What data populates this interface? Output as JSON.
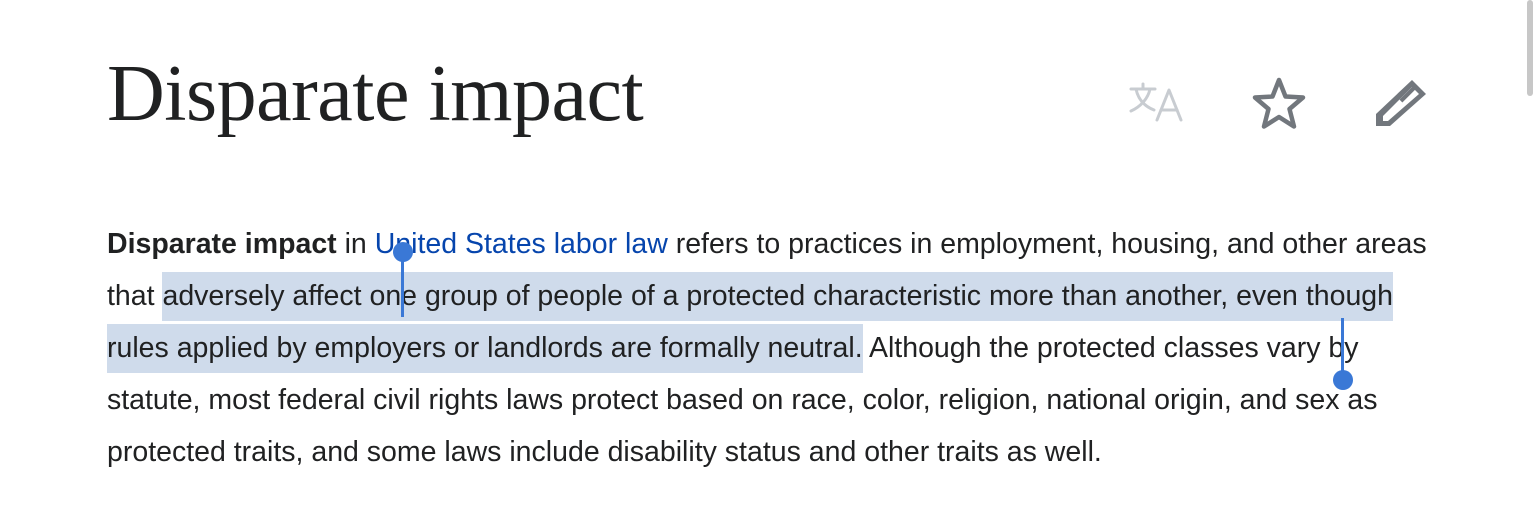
{
  "article": {
    "title": "Disparate impact",
    "lead": {
      "bold_term": "Disparate impact",
      "text_before_link": " in ",
      "link_label": "United States labor law",
      "text_after_link": " refers to practices in employment, housing, and other areas that ",
      "selected_text": "adversely affect one group of people of a protected characteristic more than another, even though rules applied by employers or landlords are formally neutral.",
      "text_after_selection": " Although the protected classes vary by statute, most federal civil rights laws protect based on race, color, religion, national origin, and sex as protected traits, and some laws include disability status and other traits as well."
    }
  },
  "toolbar": {
    "icons": [
      "language-icon",
      "watch-star-icon",
      "edit-pencil-icon"
    ]
  },
  "colors": {
    "text": "#202122",
    "link": "#0645ad",
    "selection_highlight": "#cfdbeb",
    "selection_handle": "#3a78d6",
    "icon_gray": "#72777d",
    "icon_disabled": "#c8ccd1"
  }
}
